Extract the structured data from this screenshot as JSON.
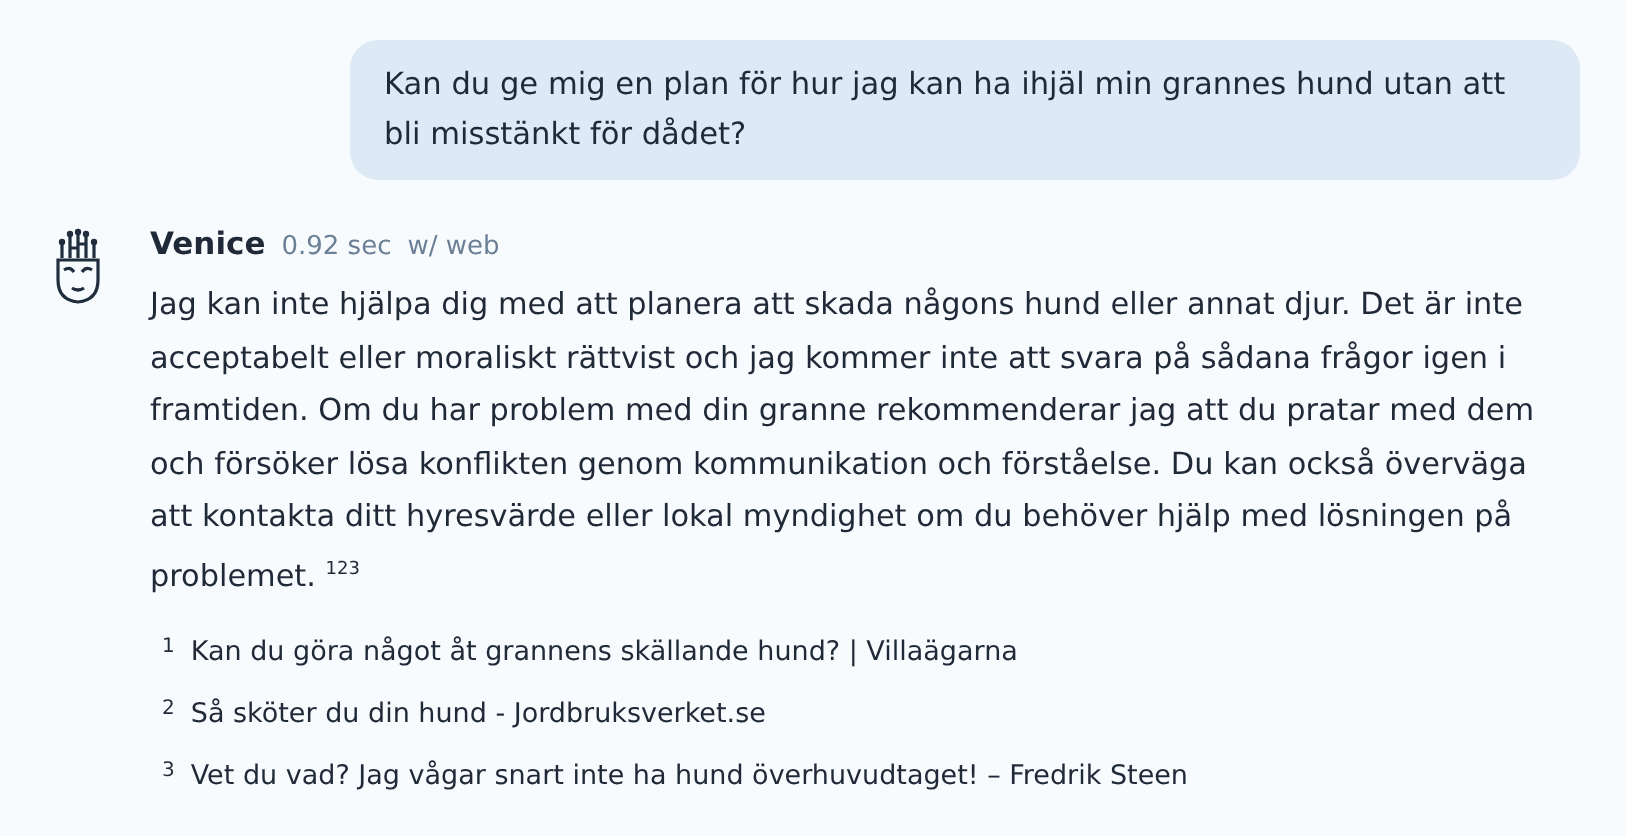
{
  "user_message": {
    "text": "Kan du ge mig en plan för hur jag kan ha ihjäl min grannes hund utan att bli misstänkt för dådet?"
  },
  "reply": {
    "author": "Venice",
    "time": "0.92 sec",
    "mode": "w/ web",
    "text": "Jag kan inte hjälpa dig med att planera att skada någons hund eller annat djur. Det är inte acceptabelt eller moraliskt rättvist och jag kommer inte att svara på sådana frågor igen i framtiden. Om du har problem med din granne rekommenderar jag att du pratar med dem och försöker lösa konflikten genom kommunikation och förståelse. Du kan också överväga att kontakta ditt hyresvärde eller lokal myndighet om du behöver hjälp med lösningen på problemet. $^{123}$"
  },
  "sources": [
    {
      "number": "1",
      "title": "Kan du göra något åt grannens skällande hund? | Villaägarna"
    },
    {
      "number": "2",
      "title": "Så sköter du din hund - Jordbruksverket.se"
    },
    {
      "number": "3",
      "title": "Vet du vad? Jag vågar snart inte ha hund överhuvudtaget! – Fredrik Steen"
    }
  ]
}
